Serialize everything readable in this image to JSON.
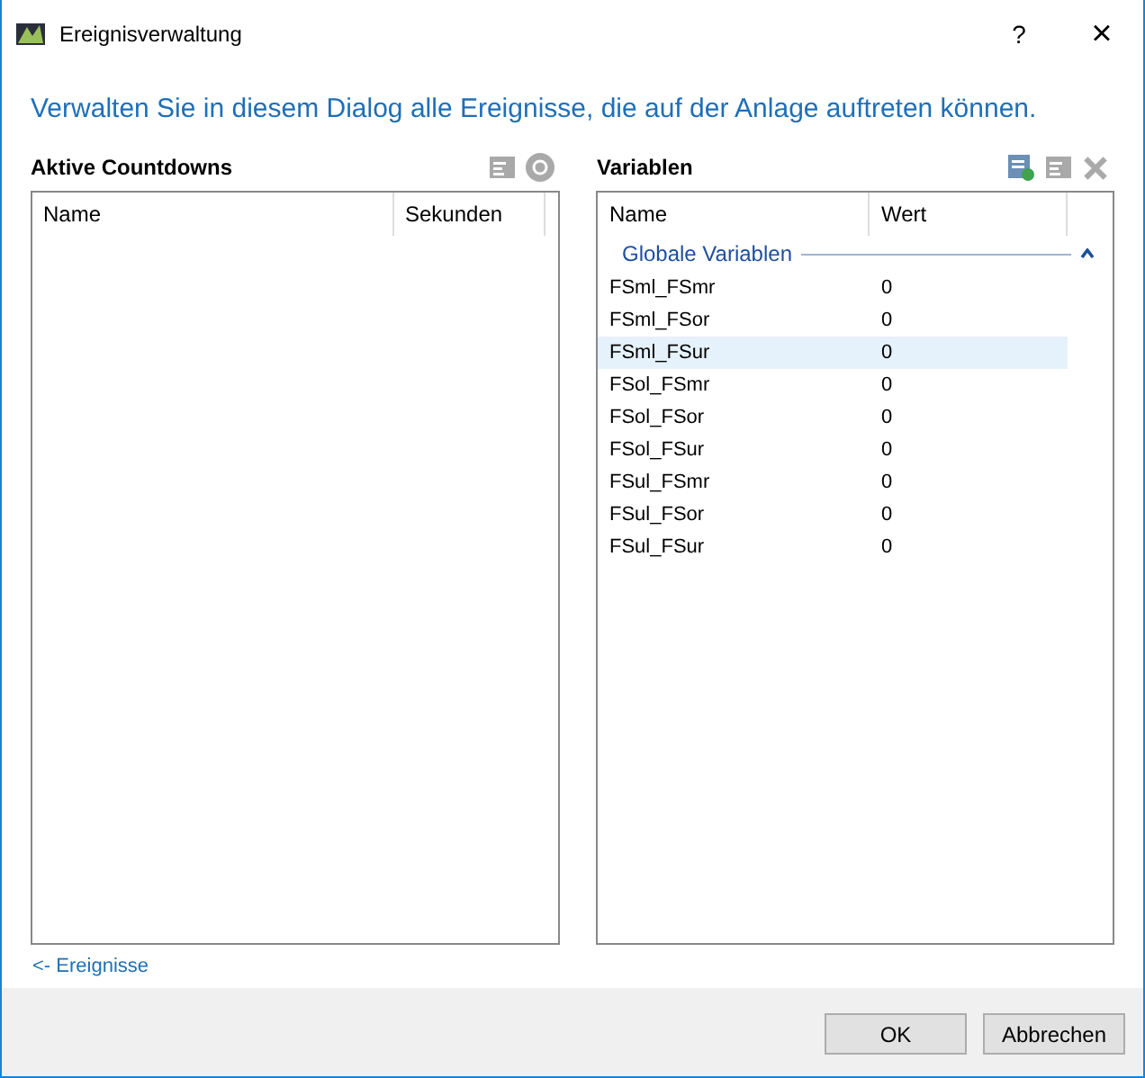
{
  "window": {
    "title": "Ereignisverwaltung",
    "help": "?",
    "close": "×"
  },
  "intro": "Verwalten Sie in diesem Dialog alle Ereignisse, die auf der Anlage auftreten können.",
  "countdowns": {
    "title": "Aktive Countdowns",
    "columns": [
      "Name",
      "Sekunden"
    ]
  },
  "variables": {
    "title": "Variablen",
    "columns": [
      "Name",
      "Wert"
    ],
    "groups": [
      {
        "label": "Globale Variablen",
        "expanded": true,
        "rows": [
          {
            "name": "FSml_FSmr",
            "value": "0",
            "selected": false
          },
          {
            "name": "FSml_FSor",
            "value": "0",
            "selected": false
          },
          {
            "name": "FSml_FSur",
            "value": "0",
            "selected": true
          },
          {
            "name": "FSol_FSmr",
            "value": "0",
            "selected": false
          },
          {
            "name": "FSol_FSor",
            "value": "0",
            "selected": false
          },
          {
            "name": "FSol_FSur",
            "value": "0",
            "selected": false
          },
          {
            "name": "FSul_FSmr",
            "value": "0",
            "selected": false
          },
          {
            "name": "FSul_FSor",
            "value": "0",
            "selected": false
          },
          {
            "name": "FSul_FSur",
            "value": "0",
            "selected": false
          }
        ]
      }
    ]
  },
  "link": "<- Ereignisse",
  "buttons": [
    "OK",
    "Abbrechen"
  ]
}
